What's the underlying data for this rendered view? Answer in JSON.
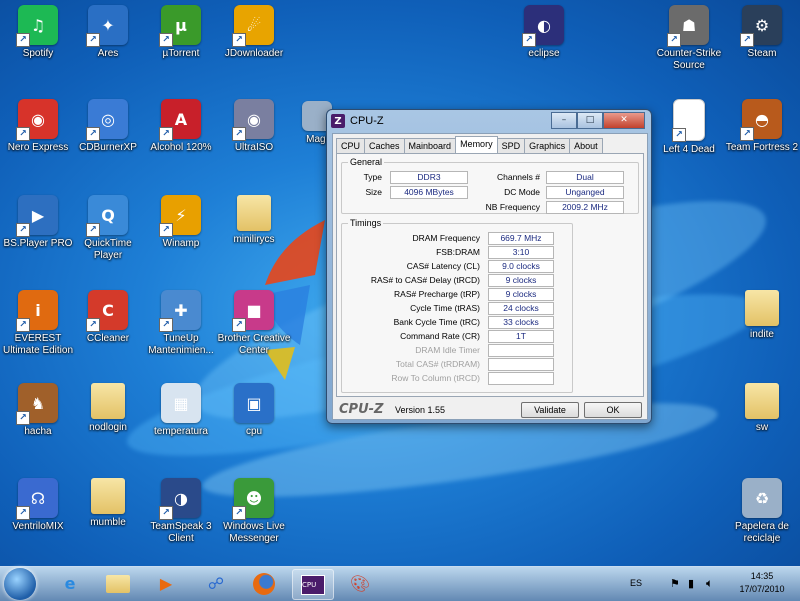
{
  "desktop_icons": [
    {
      "label": "Spotify",
      "icon": "spotify-icon",
      "color": "#1db954",
      "glyph": "♫"
    },
    {
      "label": "Ares",
      "icon": "ares-icon",
      "color": "#2a6fc4",
      "glyph": "✦"
    },
    {
      "label": "µTorrent",
      "icon": "utorrent-icon",
      "color": "#3a9a2a",
      "glyph": "µ"
    },
    {
      "label": "JDownloader",
      "icon": "jdownloader-icon",
      "color": "#e8a400",
      "glyph": "☄"
    },
    {
      "label": "eclipse",
      "icon": "eclipse-icon",
      "color": "#2c2f7a",
      "glyph": "◐"
    },
    {
      "label": "Counter-Strike Source",
      "icon": "counter-strike-icon",
      "color": "#6b6b6b",
      "glyph": "☗"
    },
    {
      "label": "Steam",
      "icon": "steam-icon",
      "color": "#2a3f5a",
      "glyph": "⚙"
    },
    {
      "label": "Nero Express",
      "icon": "nero-icon",
      "color": "#d7332a",
      "glyph": "◉"
    },
    {
      "label": "CDBurnerXP",
      "icon": "cdburner-icon",
      "color": "#3a7bd5",
      "glyph": "◎"
    },
    {
      "label": "Alcohol 120%",
      "icon": "alcohol-icon",
      "color": "#c8202a",
      "glyph": "A"
    },
    {
      "label": "UltraISO",
      "icon": "ultraiso-icon",
      "color": "#7a7fa0",
      "glyph": "◉"
    },
    {
      "label": "Left 4 Dead",
      "icon": "document-icon",
      "color": "#ffffff",
      "glyph": ""
    },
    {
      "label": "Team Fortress 2",
      "icon": "tf2-icon",
      "color": "#b85a1c",
      "glyph": "◓"
    },
    {
      "label": "BS.Player PRO",
      "icon": "bsplayer-icon",
      "color": "#2d6fc0",
      "glyph": "▶"
    },
    {
      "label": "QuickTime Player",
      "icon": "quicktime-icon",
      "color": "#3a8ad8",
      "glyph": "Q"
    },
    {
      "label": "Winamp",
      "icon": "winamp-icon",
      "color": "#e8a000",
      "glyph": "⚡"
    },
    {
      "label": "minilirycs",
      "icon": "folder-icon",
      "color": "#e8c870",
      "glyph": ""
    },
    {
      "label": "EVEREST Ultimate Edition",
      "icon": "everest-icon",
      "color": "#e06a10",
      "glyph": "i"
    },
    {
      "label": "CCleaner",
      "icon": "ccleaner-icon",
      "color": "#d43a2a",
      "glyph": "C"
    },
    {
      "label": "TuneUp Mantenimien...",
      "icon": "tuneup-icon",
      "color": "#4a8ad0",
      "glyph": "✚"
    },
    {
      "label": "Brother Creative Center",
      "icon": "brother-icon",
      "color": "#c83a8a",
      "glyph": "■"
    },
    {
      "label": "indite",
      "icon": "folder-icon",
      "color": "#e8c870",
      "glyph": ""
    },
    {
      "label": "hacha",
      "icon": "hacha-icon",
      "color": "#a0602a",
      "glyph": "♞"
    },
    {
      "label": "nodlogin",
      "icon": "folder-icon",
      "color": "#e8c870",
      "glyph": ""
    },
    {
      "label": "temperatura",
      "icon": "screenshot-icon",
      "color": "#d8e4f0",
      "glyph": "▦"
    },
    {
      "label": "cpu",
      "icon": "image-icon",
      "color": "#2a70c8",
      "glyph": "▣"
    },
    {
      "label": "sw",
      "icon": "folder-icon",
      "color": "#e8c870",
      "glyph": ""
    },
    {
      "label": "VentriloMIX",
      "icon": "ventrilo-icon",
      "color": "#3a6ad0",
      "glyph": "☊"
    },
    {
      "label": "mumble",
      "icon": "folder-icon",
      "color": "#e8c870",
      "glyph": ""
    },
    {
      "label": "TeamSpeak 3 Client",
      "icon": "teamspeak-icon",
      "color": "#2a4a8a",
      "glyph": "◑"
    },
    {
      "label": "Windows Live Messenger",
      "icon": "messenger-icon",
      "color": "#3a9a3a",
      "glyph": "☻"
    },
    {
      "label": "Papelera de reciclaje",
      "icon": "recycle-bin-icon",
      "color": "#9ab0c8",
      "glyph": "♻"
    }
  ],
  "partial_icon_label": "Magi",
  "window": {
    "title": "CPU-Z",
    "logo": "Z",
    "tabs": [
      "CPU",
      "Caches",
      "Mainboard",
      "Memory",
      "SPD",
      "Graphics",
      "About"
    ],
    "active_tab": "Memory",
    "general": {
      "title": "General",
      "type_label": "Type",
      "type_value": "DDR3",
      "size_label": "Size",
      "size_value": "4096 MBytes",
      "channels_label": "Channels #",
      "channels_value": "Dual",
      "dcmode_label": "DC Mode",
      "dcmode_value": "Unganged",
      "nbfreq_label": "NB Frequency",
      "nbfreq_value": "2009.2 MHz"
    },
    "timings": {
      "title": "Timings",
      "rows": [
        {
          "label": "DRAM Frequency",
          "value": "669.7 MHz",
          "disabled": false
        },
        {
          "label": "FSB:DRAM",
          "value": "3:10",
          "disabled": false
        },
        {
          "label": "CAS# Latency (CL)",
          "value": "9.0 clocks",
          "disabled": false
        },
        {
          "label": "RAS# to CAS# Delay (tRCD)",
          "value": "9 clocks",
          "disabled": false
        },
        {
          "label": "RAS# Precharge (tRP)",
          "value": "9 clocks",
          "disabled": false
        },
        {
          "label": "Cycle Time (tRAS)",
          "value": "24 clocks",
          "disabled": false
        },
        {
          "label": "Bank Cycle Time (tRC)",
          "value": "33 clocks",
          "disabled": false
        },
        {
          "label": "Command Rate (CR)",
          "value": "1T",
          "disabled": false
        },
        {
          "label": "DRAM Idle Timer",
          "value": "",
          "disabled": true
        },
        {
          "label": "Total CAS# (tRDRAM)",
          "value": "",
          "disabled": true
        },
        {
          "label": "Row To Column (tRCD)",
          "value": "",
          "disabled": true
        }
      ]
    },
    "footer": {
      "brand": "CPU-Z",
      "version": "Version 1.55",
      "validate": "Validate",
      "ok": "OK"
    }
  },
  "taskbar": {
    "language": "ES",
    "time": "14:35",
    "date": "17/07/2010"
  }
}
